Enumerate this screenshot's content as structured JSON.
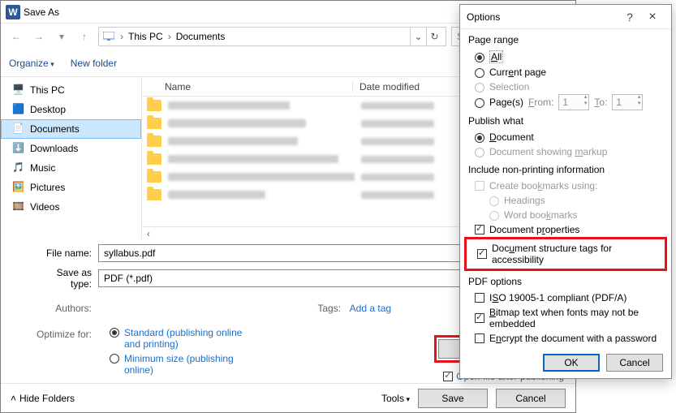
{
  "saveas": {
    "title": "Save As",
    "breadcrumb": {
      "root": "This PC",
      "folder": "Documents"
    },
    "search_placeholder": "Search D",
    "toolbar": {
      "organize": "Organize",
      "new_folder": "New folder"
    },
    "tree": {
      "this_pc": "This PC",
      "desktop": "Desktop",
      "documents": "Documents",
      "downloads": "Downloads",
      "music": "Music",
      "pictures": "Pictures",
      "videos": "Videos"
    },
    "list_headers": {
      "name": "Name",
      "date": "Date modified"
    },
    "fields": {
      "file_name_label": "File name:",
      "file_name_value": "syllabus.pdf",
      "save_type_label": "Save as type:",
      "save_type_value": "PDF (*.pdf)",
      "authors_label": "Authors:",
      "tags_label": "Tags:",
      "tags_link": "Add a tag",
      "optimize_label": "Optimize for:",
      "optimize_standard": "Standard (publishing online and printing)",
      "optimize_minimum": "Minimum size (publishing online)",
      "options_button": "Options...",
      "open_after": "Open file after publishing"
    },
    "footer": {
      "hide_folders": "Hide Folders",
      "tools": "Tools",
      "save": "Save",
      "cancel": "Cancel"
    }
  },
  "options": {
    "title": "Options",
    "page_range": {
      "title": "Page range",
      "all": "All",
      "current": "Current page",
      "selection": "Selection",
      "pages": "Page(s)",
      "from": "From:",
      "from_val": "1",
      "to": "To:",
      "to_val": "1"
    },
    "publish": {
      "title": "Publish what",
      "document": "Document",
      "markup": "Document showing markup"
    },
    "include": {
      "title": "Include non-printing information",
      "bookmarks": "Create bookmarks using:",
      "headings": "Headings",
      "word_bookmarks": "Word bookmarks",
      "doc_props": "Document properties",
      "structure_tags": "Document structure tags for accessibility"
    },
    "pdf": {
      "title": "PDF options",
      "iso": "ISO 19005-1 compliant (PDF/A)",
      "bitmap": "Bitmap text when fonts may not be embedded",
      "encrypt": "Encrypt the document with a password"
    },
    "buttons": {
      "ok": "OK",
      "cancel": "Cancel"
    }
  }
}
